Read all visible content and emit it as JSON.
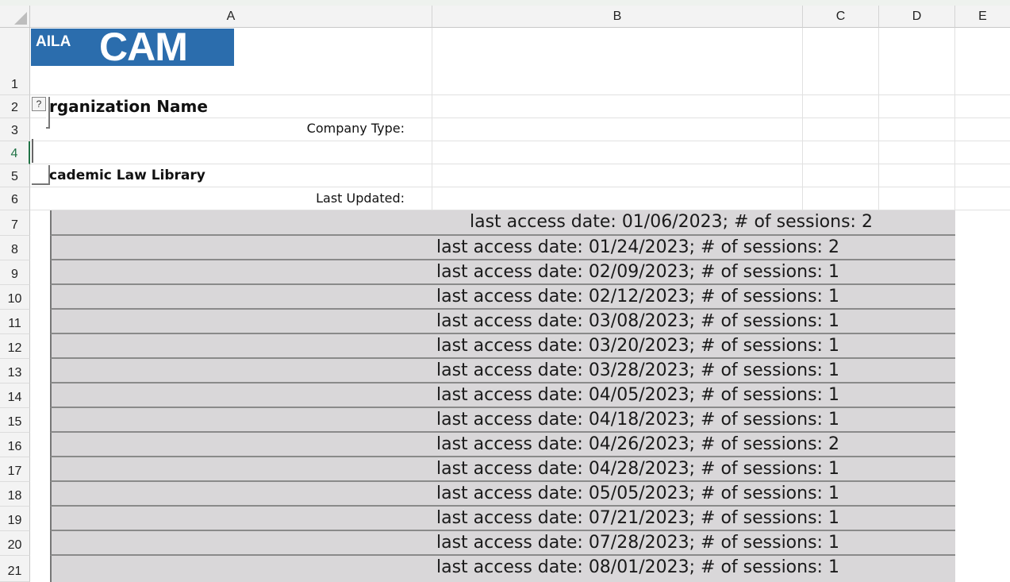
{
  "columns": [
    "A",
    "B",
    "C",
    "D",
    "E"
  ],
  "rows": [
    "1",
    "2",
    "3",
    "4",
    "5",
    "6",
    "7",
    "8",
    "9",
    "10",
    "11",
    "12",
    "13",
    "14",
    "15",
    "16",
    "17",
    "18",
    "19",
    "20",
    "21"
  ],
  "active_row": "4",
  "logo": {
    "small": "AILA",
    "big": "CAM",
    "color": "#2b6dad"
  },
  "help_icon": "?",
  "cells": {
    "organization_name": "rganization Name",
    "company_type_label": "Company Type:",
    "library": "cademic Law Library",
    "last_updated_label": "Last Updated:"
  },
  "access_records": [
    "last access date: 01/06/2023; # of sessions: 2",
    "last access date: 01/24/2023; # of sessions: 2",
    "last access date: 02/09/2023; # of sessions: 1",
    "last access date: 02/12/2023; # of sessions: 1",
    "last access date: 03/08/2023; # of sessions: 1",
    "last access date: 03/20/2023; # of sessions: 1",
    "last access date: 03/28/2023; # of sessions: 1",
    "last access date: 04/05/2023; # of sessions: 1",
    "last access date: 04/18/2023; # of sessions: 1",
    "last access date: 04/26/2023; # of sessions: 2",
    "last access date: 04/28/2023; # of sessions: 1",
    "last access date: 05/05/2023; # of sessions: 1",
    "last access date: 07/21/2023; # of sessions: 1",
    "last access date: 07/28/2023; # of sessions: 1",
    "last access date: 08/01/2023; # of sessions: 1"
  ]
}
